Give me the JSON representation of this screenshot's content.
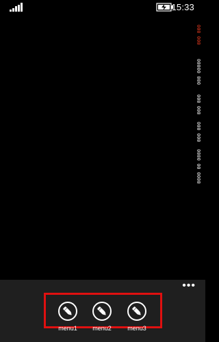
{
  "status_bar": {
    "time": "15:33",
    "signal_icon": "signal-strength-icon",
    "battery_icon": "battery-charging-icon"
  },
  "debug_column": {
    "lines": [
      {
        "text": "000 000",
        "color": "#e53a1f"
      },
      {
        "text": "00000 000",
        "color": "#f3f3f3"
      },
      {
        "text": "000 000",
        "color": "#f3f3f3"
      },
      {
        "text": "000 000",
        "color": "#f3f3f3"
      },
      {
        "text": "0000 00 0000",
        "color": "#f3f3f3"
      }
    ]
  },
  "app_bar": {
    "more_label": "•••",
    "highlight_color": "#e01010",
    "buttons": [
      {
        "label": "menu1",
        "icon": "edit-pen-icon"
      },
      {
        "label": "menu2",
        "icon": "edit-pen-icon"
      },
      {
        "label": "menu3",
        "icon": "edit-pen-icon"
      }
    ]
  }
}
